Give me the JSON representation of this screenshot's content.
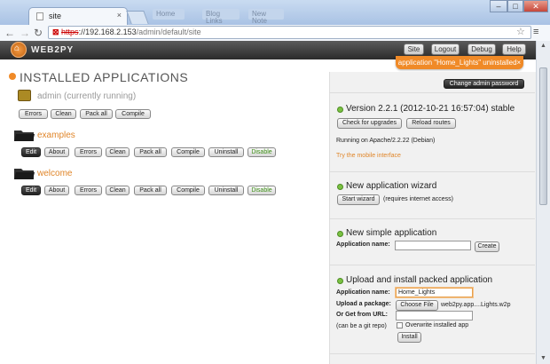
{
  "browser": {
    "tab_title": "site",
    "tab_close": "×",
    "ghost_tabs": [
      "Home",
      "Blog Links",
      "New Note"
    ],
    "url_scheme": "https",
    "url_host": "://192.168.2.153",
    "url_path": "/admin/default/site"
  },
  "header": {
    "logo_text": "WEB2PY",
    "nav": [
      "Site",
      "Logout",
      "Debug",
      "Help"
    ],
    "flash": "application \"Home_Lights\" uninstalled×"
  },
  "main": {
    "title": "INSTALLED APPLICATIONS",
    "apps": [
      {
        "name": "admin (currently running)",
        "buttons": [
          "Errors",
          "Clean",
          "Pack all",
          "Compile"
        ]
      },
      {
        "name": "examples",
        "buttons": [
          "Edit",
          "About",
          "Errors",
          "Clean",
          "Pack all",
          "Compile",
          "Uninstall",
          "Disable"
        ]
      },
      {
        "name": "welcome",
        "buttons": [
          "Edit",
          "About",
          "Errors",
          "Clean",
          "Pack all",
          "Compile",
          "Uninstall",
          "Disable"
        ]
      }
    ]
  },
  "sidebar": {
    "change_password": "Change admin password",
    "version": {
      "title": "Version 2.2.1 (2012-10-21 16:57:04) stable",
      "check_upgrades": "Check for upgrades",
      "reload_routes": "Reload routes",
      "running_on": "Running on Apache/2.2.22 (Debian)",
      "mobile_link": "Try the mobile interface"
    },
    "wizard": {
      "title": "New application wizard",
      "start": "Start wizard",
      "note": "(requires internet access)"
    },
    "simple": {
      "title": "New simple application",
      "label": "Application name:",
      "value": "",
      "create": "Create"
    },
    "upload": {
      "title": "Upload and install packed application",
      "name_label": "Application name:",
      "name_value": "Home_Lights",
      "package_label": "Upload a package:",
      "choose_file": "Choose File",
      "file_name": "web2py.app....Lights.w2p",
      "url_label": "Or Get from URL:",
      "url_value": "",
      "git_note": "(can be a git repo)",
      "overwrite": "Overwrite installed app",
      "install": "Install"
    }
  }
}
